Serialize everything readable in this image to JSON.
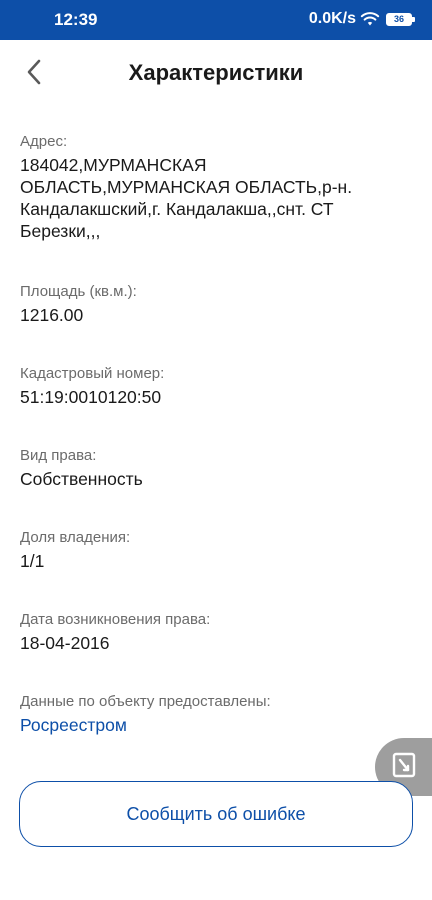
{
  "status_bar": {
    "time": "12:39",
    "network_speed": "0.0K/s",
    "battery_level": "36"
  },
  "header": {
    "title": "Характеристики"
  },
  "fields": [
    {
      "label": "Адрес:",
      "value": "184042,МУРМАНСКАЯ ОБЛАСТЬ,МУРМАНСКАЯ ОБЛАСТЬ,р-н. Кандалакшский,г. Кандалакша,,снт. СТ Березки,,,"
    },
    {
      "label": "Площадь (кв.м.):",
      "value": "1216.00"
    },
    {
      "label": "Кадастровый номер:",
      "value": "51:19:0010120:50"
    },
    {
      "label": "Вид права:",
      "value": "Собственность"
    },
    {
      "label": "Доля владения:",
      "value": "1/1"
    },
    {
      "label": "Дата возникновения права:",
      "value": "18-04-2016"
    },
    {
      "label": "Данные по объекту предоставлены:",
      "value": "Росреестром"
    }
  ],
  "actions": {
    "report_error_label": "Сообщить об ошибке"
  },
  "colors": {
    "accent": "#0d4fa8",
    "label_gray": "#6b6b6b",
    "floating_button": "#9e9e9e"
  },
  "icons": {
    "back": "chevron-left-icon",
    "wifi": "wifi-icon",
    "battery": "battery-icon",
    "floating": "document-icon"
  }
}
